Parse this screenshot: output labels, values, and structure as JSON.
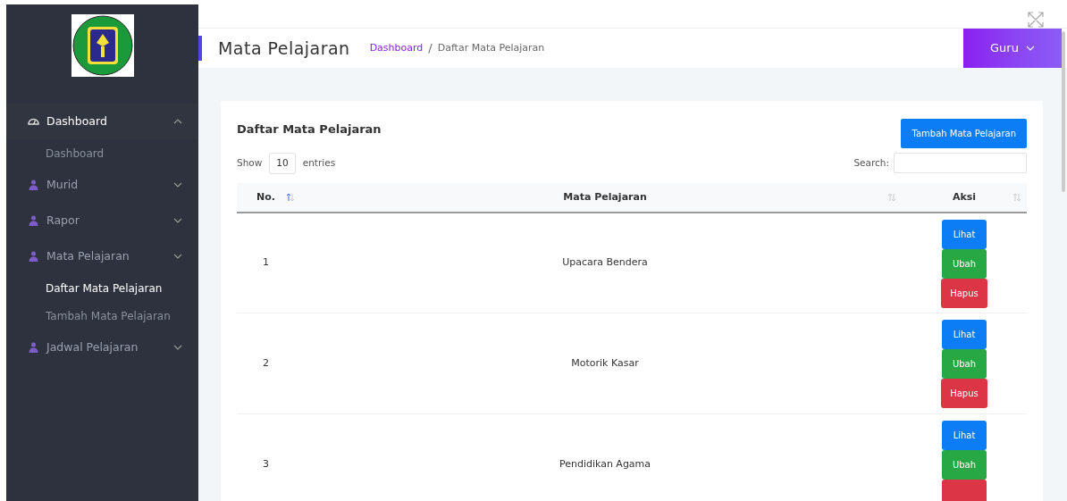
{
  "sidebar": {
    "items": [
      {
        "label": "Dashboard",
        "kind": "dashboard",
        "expanded": true,
        "selected": true,
        "children": [
          {
            "label": "Dashboard",
            "selected": false
          }
        ]
      },
      {
        "label": "Murid",
        "kind": "user",
        "expanded": false,
        "selected": false
      },
      {
        "label": "Rapor",
        "kind": "user",
        "expanded": false,
        "selected": false
      },
      {
        "label": "Mata Pelajaran",
        "kind": "user",
        "expanded": false,
        "selected": false,
        "children": [
          {
            "label": "Daftar Mata Pelajaran",
            "selected": true
          },
          {
            "label": "Tambah Mata Pelajaran",
            "selected": false
          }
        ]
      },
      {
        "label": "Jadwal Pelajaran",
        "kind": "user",
        "expanded": false,
        "selected": false
      }
    ]
  },
  "header": {
    "title": "Mata Pelajaran",
    "breadcrumb": [
      "Dashboard",
      "/",
      "Daftar Mata Pelajaran"
    ],
    "user_menu": "Guru"
  },
  "card": {
    "title": "Daftar Mata Pelajaran",
    "add_button": "Tambah Mata Pelajaran",
    "length": {
      "before": "Show",
      "value": "10",
      "after": "entries"
    },
    "search_label": "Search:",
    "table": {
      "columns": [
        {
          "label": "No.",
          "sorted": true
        },
        {
          "label": "Mata Pelajaran",
          "sorted": false
        },
        {
          "label": "Aksi",
          "sorted": false
        }
      ],
      "rows": [
        {
          "no": "1",
          "name": "Upacara Bendera",
          "actions": [
            {
              "kind": "view",
              "label": "Lihat"
            },
            {
              "kind": "edit",
              "label": "Ubah"
            },
            {
              "kind": "delete",
              "label": "Hapus"
            }
          ]
        },
        {
          "no": "2",
          "name": "Motorik Kasar",
          "actions": [
            {
              "kind": "view",
              "label": "Lihat"
            },
            {
              "kind": "edit",
              "label": "Ubah"
            },
            {
              "kind": "delete",
              "label": "Hapus"
            }
          ]
        },
        {
          "no": "3",
          "name": "Pendidikan Agama",
          "actions": [
            {
              "kind": "view",
              "label": "Lihat"
            },
            {
              "kind": "edit",
              "label": "Ubah"
            },
            {
              "kind": "delete"
            }
          ]
        }
      ]
    }
  }
}
